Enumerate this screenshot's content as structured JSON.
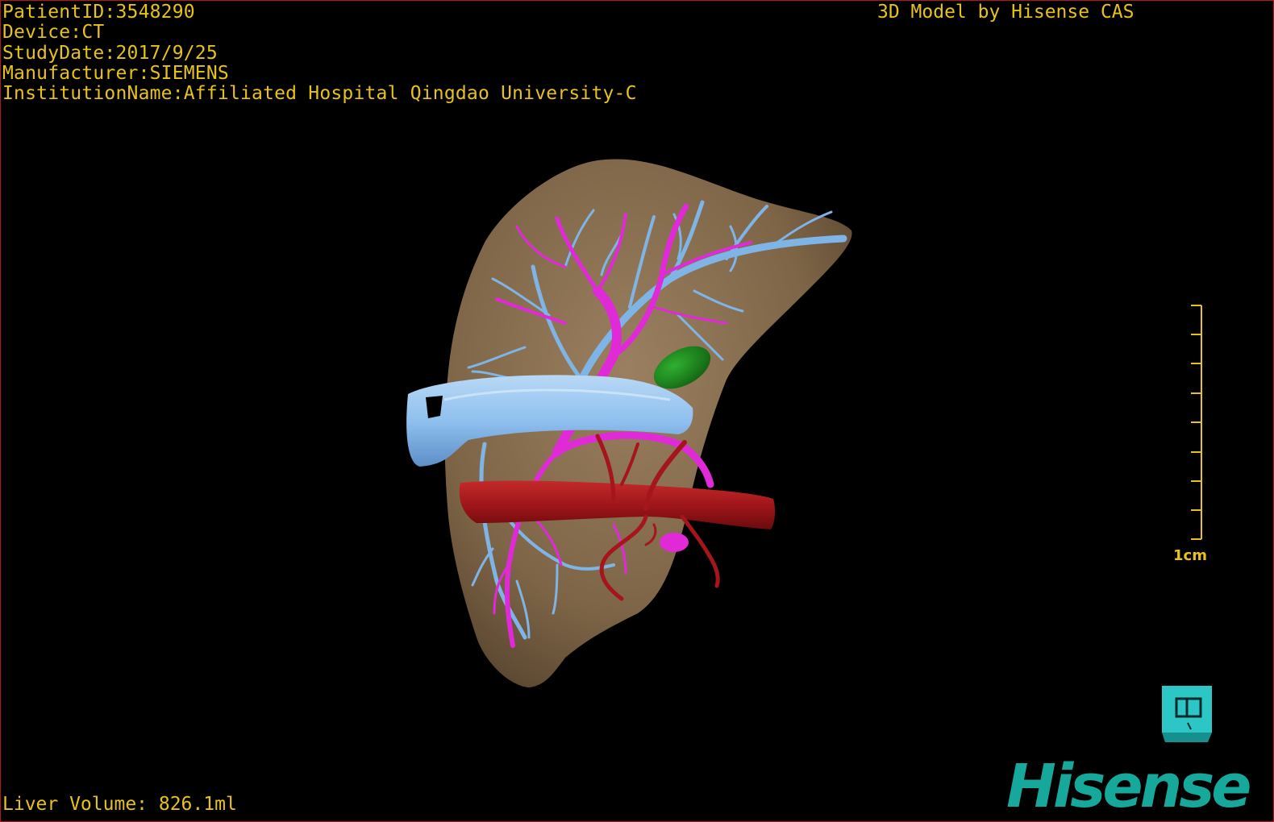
{
  "header": {
    "patient_id": "PatientID:3548290",
    "device": "Device:CT",
    "study_date": "StudyDate:2017/9/25",
    "manufacturer": "Manufacturer:SIEMENS",
    "institution": "InstitutionName:Affiliated Hospital Qingdao University-C"
  },
  "credit": "3D Model by Hisense CAS",
  "scale_bar": {
    "label": "1cm"
  },
  "footer": {
    "liver_volume": "Liver Volume: 826.1ml"
  },
  "brand": {
    "logo_text": "Hisense"
  },
  "colors": {
    "text": "#e8c21a",
    "frame": "#b01818",
    "liver": "#8a7150",
    "hepatic_vein": "#7fb4e6",
    "portal_vein": "#e02ad8",
    "artery": "#a4161b",
    "gallbladder": "#1f8f1f",
    "brand": "#16a89a"
  }
}
